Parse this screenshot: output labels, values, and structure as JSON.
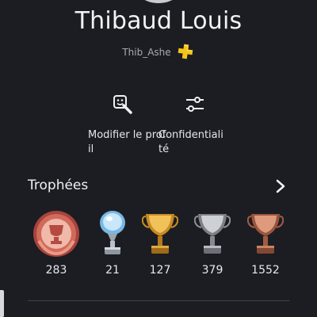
{
  "profile": {
    "name": "Thibaud Louis",
    "online_id": "Thib_Ashe",
    "plus_icon": "playstation-plus-icon"
  },
  "actions": [
    {
      "label": "Modifier le profil",
      "icon": "edit-profile-icon"
    },
    {
      "label": "Confidentialité",
      "icon": "sliders-icon"
    }
  ],
  "trophies": {
    "title": "Trophées",
    "level_count": "283",
    "platinum_count": "21",
    "gold_count": "127",
    "silver_count": "379",
    "bronze_count": "1552"
  },
  "colors": {
    "background": "#1c1d23",
    "plus_gold": "#f6c417",
    "level_badge": "#c4584b",
    "platinum": "#8fc6ee",
    "gold": "#d9a23a",
    "silver": "#a9abb0",
    "bronze": "#c07a5c"
  }
}
